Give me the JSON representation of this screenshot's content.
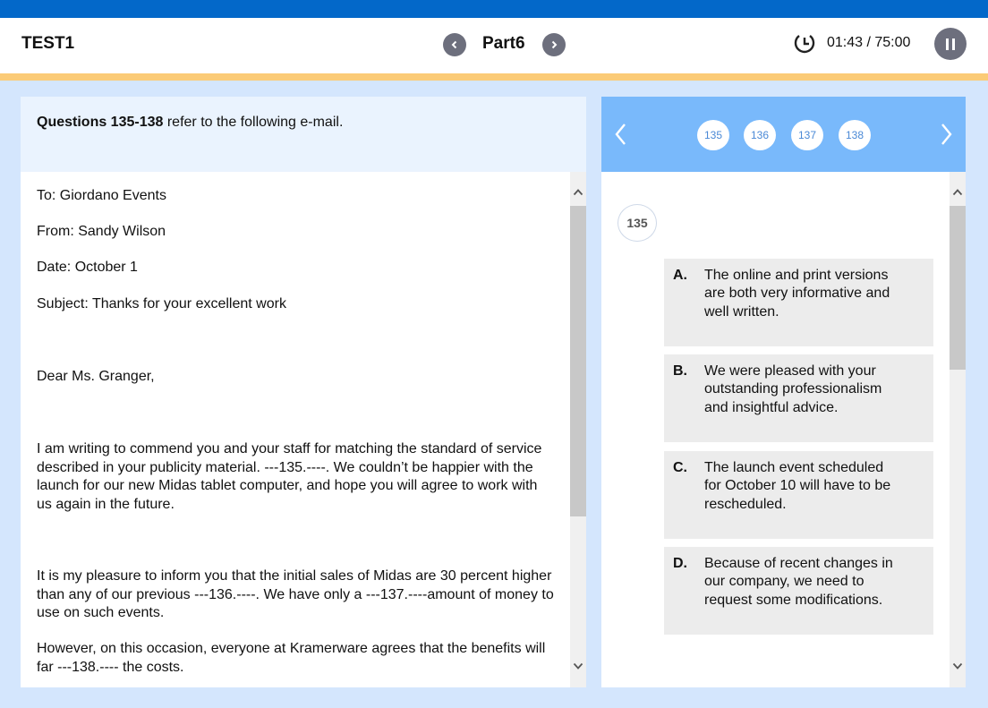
{
  "header": {
    "test_title": "TEST1",
    "part_label": "Part6",
    "timer": "01:43 / 75:00",
    "icons": {
      "prev": "chevron-left-icon",
      "next": "chevron-right-icon",
      "timer": "clock-icon",
      "pause": "pause-icon"
    }
  },
  "colors": {
    "top_strip": "#0368c9",
    "accent_line": "#fbcb77",
    "page_bg": "#d4e6fd",
    "nav_button": "#6d6f7d",
    "question_nav_bg": "#79b9fb",
    "option_bg": "#ececec"
  },
  "passage": {
    "intro_bold": "Questions 135-138",
    "intro_rest": " refer to the following e-mail.",
    "paragraphs": [
      "To: Giordano Events",
      "From: Sandy Wilson",
      "Date: October 1",
      "Subject: Thanks for your excellent work",
      "Dear Ms. Granger,",
      "I am writing to commend you and your staff for matching the standard of service described in your publicity material. ---135.----. We couldn’t be happier with the launch for our new Midas tablet computer, and hope you will agree to work with us again in the future.",
      "It is my pleasure to inform you that the initial sales of Midas are 30 percent higher than any of our previous ---136.----. We have only a ---137.----amount of money to use on such events.",
      "However, on this occasion, everyone at Kramerware agrees that the benefits will far ---138.---- the costs."
    ]
  },
  "question_nav": {
    "numbers": [
      "135",
      "136",
      "137",
      "138"
    ]
  },
  "question": {
    "number": "135",
    "options": [
      {
        "letter": "A.",
        "text": "The online and print versions are both very informative and well written."
      },
      {
        "letter": "B.",
        "text": "We were pleased with your outstanding professionalism and insightful advice."
      },
      {
        "letter": "C.",
        "text": "The launch event scheduled for October 10 will have to be rescheduled."
      },
      {
        "letter": "D.",
        "text": "Because of recent changes in our company, we need to request some modifications."
      }
    ]
  }
}
